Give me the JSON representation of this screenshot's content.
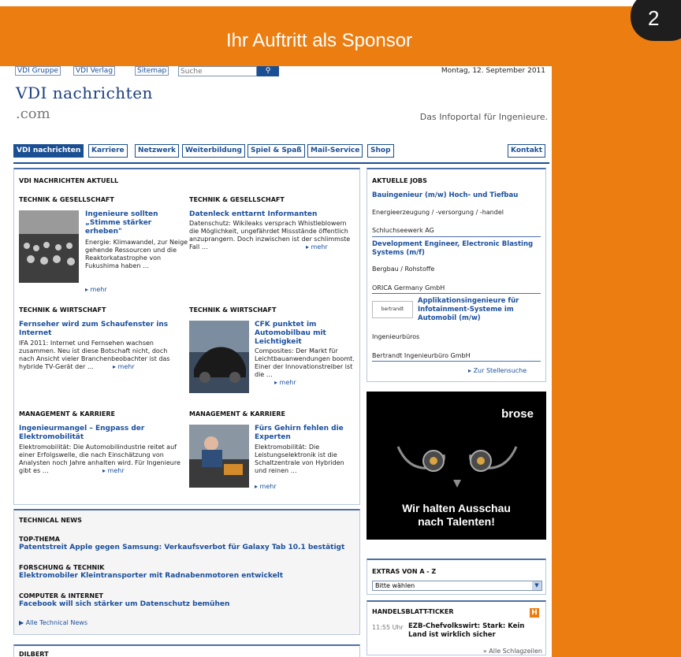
{
  "slide": {
    "title": "Ihr Auftritt als Sponsor",
    "page_number": "2",
    "accent_color": "#ec7d11"
  },
  "site": {
    "top_links": [
      "VDI Gruppe",
      "VDI Verlag",
      "Sitemap"
    ],
    "search": {
      "placeholder": "Suche",
      "button_icon": "search-icon"
    },
    "date": "Montag, 12. September 2011",
    "logo_line1": "VDI nachrichten",
    "logo_line2": ".com",
    "tagline": "Das Infoportal für Ingenieure.",
    "nav": {
      "items": [
        "VDI nachrichten",
        "Karriere",
        "Netzwerk",
        "Weiterbildung",
        "Spiel & Spaß",
        "Mail-Service",
        "Shop"
      ],
      "contact": "Kontakt"
    },
    "aktuell": {
      "heading": "VDI NACHRICHTEN AKTUELL",
      "articles": [
        {
          "kicker": "TECHNIK & GESELLSCHAFT",
          "headline": "Ingenieure sollten „Stimme stärker erheben\"",
          "teaser": "Energie: Klimawandel, zur Neige gehende Ressourcen und die Reaktorkatastrophe von Fukushima haben …",
          "more": "▸ mehr"
        },
        {
          "kicker": "TECHNIK & GESELLSCHAFT",
          "headline": "Datenleck enttarnt Informanten",
          "teaser": "Datenschutz: Wikileaks versprach Whistleblowern die Möglichkeit, ungefährdet Missstände öffentlich anzuprangern. Doch inzwischen ist der schlimmste Fall …",
          "more": "▸ mehr"
        },
        {
          "kicker": "TECHNIK & WIRTSCHAFT",
          "headline": "Fernseher wird zum Schaufenster ins Internet",
          "teaser": "IFA 2011: Internet und Fernsehen wachsen zusammen. Neu ist diese Botschaft nicht, doch nach Ansicht vieler Branchenbeobachter ist das hybride TV-Gerät der …",
          "more": "▸ mehr"
        },
        {
          "kicker": "TECHNIK & WIRTSCHAFT",
          "headline": "CFK punktet im Automobilbau mit Leichtigkeit",
          "teaser": "Composites: Der Markt für Leichtbauanwendungen boomt. Einer der Innovationstreiber ist die …",
          "more": "▸ mehr"
        },
        {
          "kicker": "MANAGEMENT & KARRIERE",
          "headline": "Ingenieurmangel – Engpass der Elektromobilität",
          "teaser": "Elektromobilität: Die Automobilindustrie reitet auf einer Erfolgswelle, die nach Einschätzung von Analysten noch Jahre anhalten wird. Für Ingenieure gibt es …",
          "more": "▸ mehr"
        },
        {
          "kicker": "MANAGEMENT & KARRIERE",
          "headline": "Fürs Gehirn fehlen die Experten",
          "teaser": "Elektromobilität: Die Leistungselektronik ist die Schaltzentrale von Hybriden und reinen …",
          "more": "▸ mehr"
        }
      ]
    },
    "technical_news": {
      "heading": "TECHNICAL NEWS",
      "items": [
        {
          "kicker": "TOP-THEMA",
          "headline": "Patentstreit Apple gegen Samsung: Verkaufsverbot für Galaxy Tab 10.1 bestätigt"
        },
        {
          "kicker": "FORSCHUNG & TECHNIK",
          "headline": "Elektromobiler Kleintransporter mit Radnabenmotoren entwickelt"
        },
        {
          "kicker": "COMPUTER & INTERNET",
          "headline": "Facebook will sich stärker um Datenschutz bemühen"
        }
      ],
      "all_link": "Alle Technical News"
    },
    "dilbert": {
      "heading": "DILBERT"
    },
    "jobs": {
      "heading": "AKTUELLE JOBS",
      "items": [
        {
          "title": "Bauingenieur (m/w) Hoch- und Tiefbau",
          "category": "Energieerzeugung / -versorgung / -handel",
          "company": "Schluchseewerk AG"
        },
        {
          "title": "Development Engineer, Electronic Blasting Systems (m/f)",
          "category": "Bergbau / Rohstoffe",
          "company": "ORICA Germany GmbH"
        },
        {
          "title": "Applikationsingenieure für Infotainment-Systeme im Automobil (m/w)",
          "category": "Ingenieurbüros",
          "company": "Bertrandt Ingenieurbüro GmbH",
          "logo_text": "bertrandt"
        }
      ],
      "all_link": "Zur Stellensuche"
    },
    "ad": {
      "brand": "brose",
      "slogan_line1": "Wir halten Ausschau",
      "slogan_line2": "nach Talenten!"
    },
    "extras": {
      "heading": "EXTRAS VON A - Z",
      "select_value": "Bitte wählen"
    },
    "ticker": {
      "heading": "HANDELSBLATT-TICKER",
      "badge": "H",
      "time": "11:55 Uhr",
      "headline": "EZB-Chefvolkswirt: Stark: Kein Land ist wirklich sicher",
      "all_link": "» Alle Schlagzeilen"
    }
  }
}
